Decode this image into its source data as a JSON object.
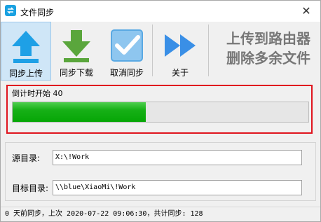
{
  "window": {
    "title": "文件同步",
    "close_glyph": "✕"
  },
  "toolbar": {
    "upload_label": "同步上传",
    "download_label": "同步下载",
    "cancel_label": "取消同步",
    "about_label": "关于"
  },
  "slogan": {
    "line1": "上传到路由器",
    "line2": "删除多余文件"
  },
  "progress": {
    "countdown_label": "倒计时开始 40",
    "fraction": 0.45
  },
  "dirs": {
    "source_label": "源目录:",
    "source_value": "X:\\!Work",
    "target_label": "目标目录:",
    "target_value": "\\\\blue\\XiaoMi\\!Work"
  },
  "status": {
    "text": "0 天前同步，上次 2020-07-22 09:06:30，共计同步: 128"
  },
  "colors": {
    "accent": "#1aa1e1",
    "download": "#5aa63c",
    "progress": "#16b016",
    "highlight": "#e0141e"
  }
}
